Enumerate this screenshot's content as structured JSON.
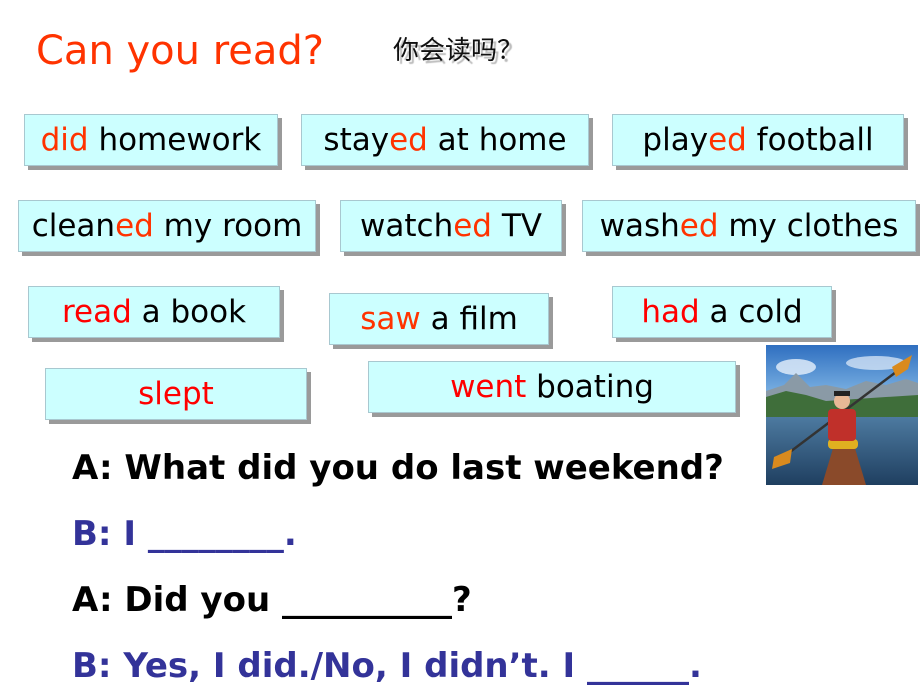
{
  "title": "Can you read?",
  "subtitle": "你会读吗？",
  "phrases": [
    {
      "highlight": "did",
      "prefix": "",
      "rest": " homework"
    },
    {
      "prefix": "stay",
      "highlight": "ed",
      "rest": " at home"
    },
    {
      "prefix": "play",
      "highlight": "ed",
      "rest": " football"
    },
    {
      "prefix": "clean",
      "highlight": "ed",
      "rest": " my room"
    },
    {
      "prefix": "watch",
      "highlight": "ed",
      "rest": " TV"
    },
    {
      "prefix": "wash",
      "highlight": "ed",
      "rest": " my clothes"
    },
    {
      "prefix": "",
      "highlight": "read",
      "rest": " a book"
    },
    {
      "prefix": "",
      "highlight": "saw",
      "rest": " a film"
    },
    {
      "prefix": "",
      "highlight": "had",
      "rest": " a cold"
    },
    {
      "prefix": "",
      "highlight": "slept",
      "rest": ""
    },
    {
      "prefix": "",
      "highlight": "went",
      "rest": " boating"
    }
  ],
  "photo": {
    "alt": "man kayaking on a mountain lake"
  },
  "dialogue": [
    {
      "speaker": "A",
      "text": "A: What did you do last weekend?"
    },
    {
      "speaker": "B",
      "text": "B: I ________."
    },
    {
      "speaker": "A",
      "text": "A: Did you __________?"
    },
    {
      "speaker": "B",
      "text": "B: Yes, I did./No, I didn’t. I ______."
    }
  ],
  "colors": {
    "title": "#ff3300",
    "highlight": "#ff3300",
    "box_bg": "#ccffff",
    "speaker_b": "#333399"
  }
}
